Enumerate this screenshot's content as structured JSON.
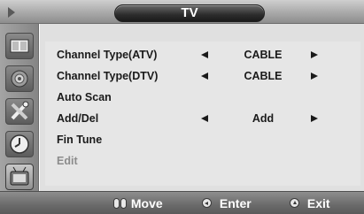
{
  "header": {
    "title": "TV"
  },
  "sidebar": {
    "items": [
      {
        "icon": "picture-icon"
      },
      {
        "icon": "sound-icon"
      },
      {
        "icon": "setup-tools-icon"
      },
      {
        "icon": "clock-icon"
      },
      {
        "icon": "tv-channel-icon",
        "selected": true
      }
    ]
  },
  "menu": {
    "items": [
      {
        "label": "Channel Type(ATV)",
        "value": "CABLE"
      },
      {
        "label": "Channel Type(DTV)",
        "value": "CABLE"
      },
      {
        "label": "Auto Scan"
      },
      {
        "label": "Add/Del",
        "value": "Add"
      },
      {
        "label": "Fin Tune"
      },
      {
        "label": "Edit",
        "disabled": true
      }
    ]
  },
  "footer": {
    "move_label": "Move",
    "enter_label": "Enter",
    "exit_label": "Exit"
  }
}
